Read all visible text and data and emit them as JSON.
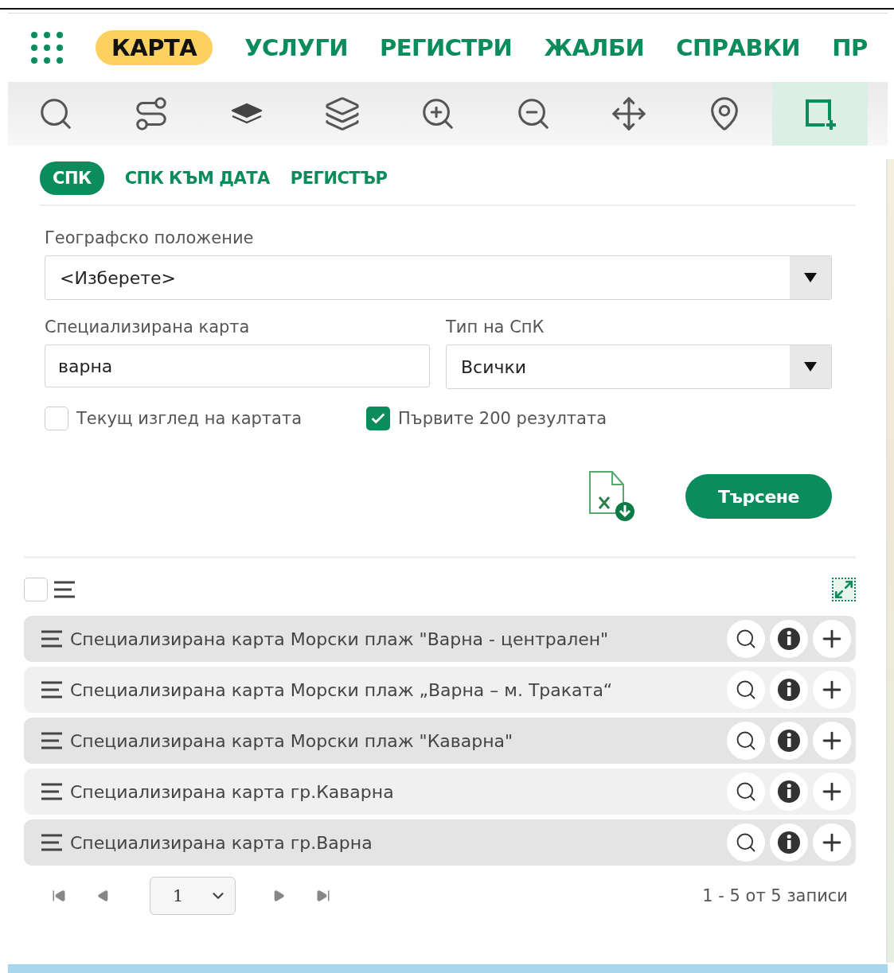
{
  "nav": {
    "items": [
      {
        "label": "КАРТА",
        "selected": true
      },
      {
        "label": "УСЛУГИ",
        "selected": false
      },
      {
        "label": "РЕГИСТРИ",
        "selected": false
      },
      {
        "label": "ЖАЛБИ",
        "selected": false
      },
      {
        "label": "СПРАВКИ",
        "selected": false
      },
      {
        "label": "ПР",
        "selected": false
      }
    ]
  },
  "toolbar": [
    {
      "kind": "search",
      "selected": false
    },
    {
      "kind": "route",
      "selected": false
    },
    {
      "kind": "layers-filled",
      "selected": false
    },
    {
      "kind": "layers",
      "selected": false
    },
    {
      "kind": "zoom-in",
      "selected": false
    },
    {
      "kind": "zoom-out",
      "selected": false
    },
    {
      "kind": "move",
      "selected": false
    },
    {
      "kind": "pin",
      "selected": false
    },
    {
      "kind": "select-area",
      "selected": true
    }
  ],
  "tabs": [
    {
      "label": "СПК",
      "selected": true
    },
    {
      "label": "СПК КЪМ ДАТА",
      "selected": false
    },
    {
      "label": "РЕГИСТЪР",
      "selected": false
    }
  ],
  "form": {
    "location": {
      "label": "Географско положение",
      "value": "<Изберете>"
    },
    "map": {
      "label": "Специализирана карта",
      "value": "варна"
    },
    "type": {
      "label": "Тип на СпК",
      "value": "Всички"
    },
    "checkboxes": [
      {
        "label": "Текущ изглед на картата",
        "checked": false
      },
      {
        "label": "Първите 200 резултата",
        "checked": true
      }
    ],
    "search_button": "Търсене"
  },
  "results": {
    "select_all": {
      "checked": false
    },
    "rows": [
      {
        "title": "Специализирана карта Морски плаж \"Варна - централен\""
      },
      {
        "title": "Специализирана карта Морски плаж „Варна – м. Траката“"
      },
      {
        "title": "Специализирана карта Морски плаж \"Каварна\""
      },
      {
        "title": "Специализирана карта гр.Каварна"
      },
      {
        "title": "Специализирана карта гр.Варна"
      }
    ]
  },
  "pagination": {
    "page": "1",
    "summary": "1 - 5 от 5 записи"
  }
}
